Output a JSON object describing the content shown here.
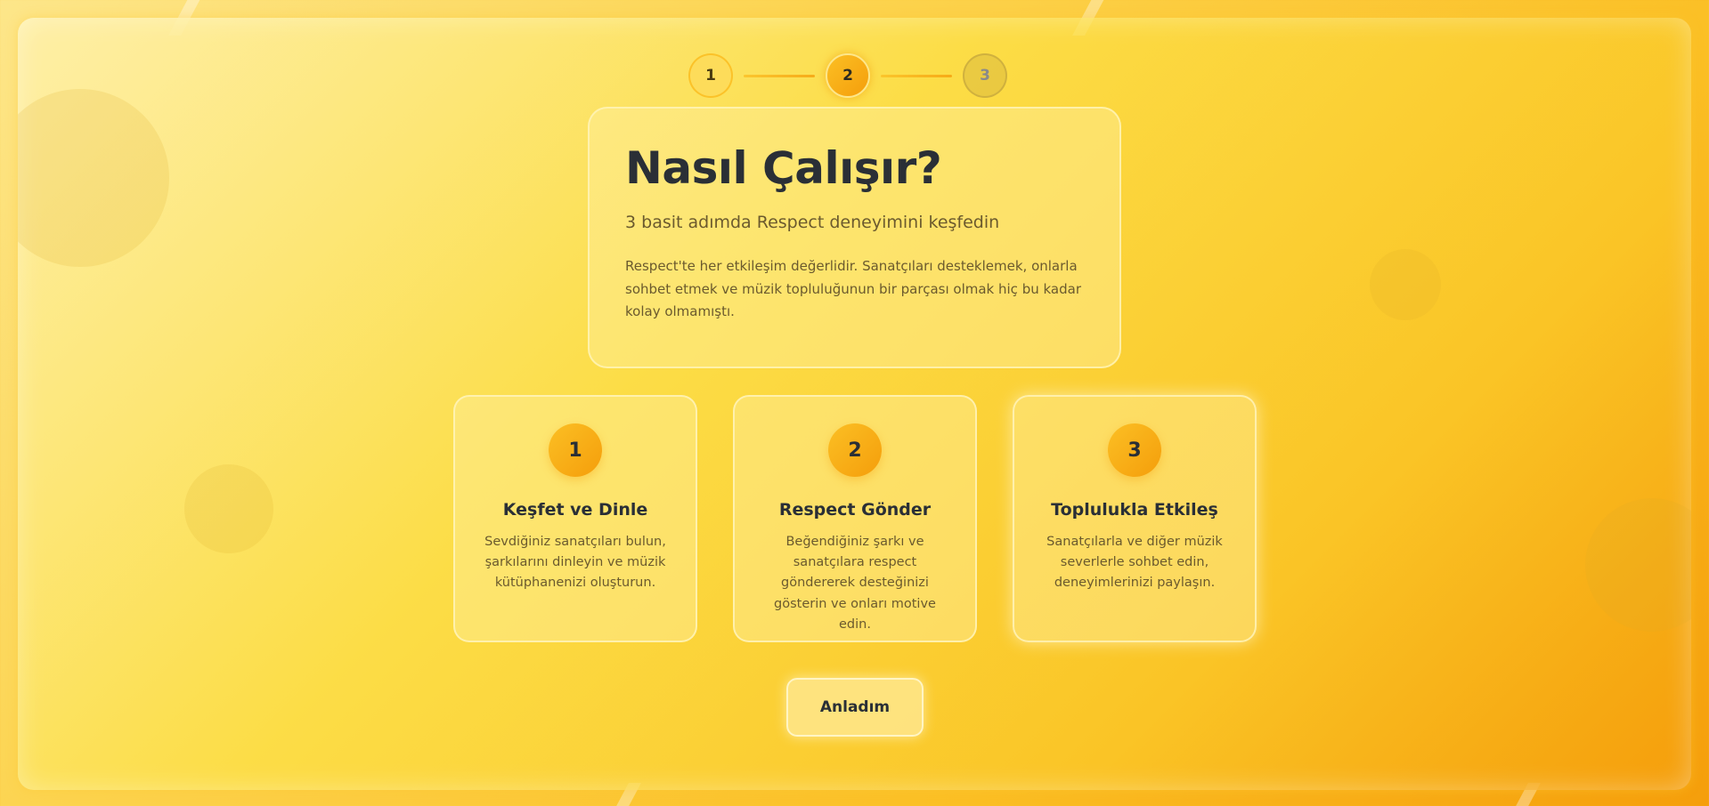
{
  "stepper": {
    "steps": [
      {
        "label": "1",
        "state": "done"
      },
      {
        "label": "2",
        "state": "active"
      },
      {
        "label": "3",
        "state": "todo"
      }
    ]
  },
  "intro": {
    "title": "Nasıl Çalışır?",
    "subtitle": "3 basit adımda Respect deneyimini keşfedin",
    "description": "Respect'te her etkileşim değerlidir. Sanatçıları desteklemek, onlarla sohbet etmek ve müzik topluluğunun bir parçası olmak hiç bu kadar kolay olmamıştı."
  },
  "cards": [
    {
      "number": "1",
      "title": "Keşfet ve Dinle",
      "text": "Sevdiğiniz sanatçıları bulun, şarkılarını dinleyin ve müzik kütüphanenizi oluşturun."
    },
    {
      "number": "2",
      "title": "Respect Gönder",
      "text": "Beğendiğiniz şarkı ve sanatçılara respect göndererek desteğinizi gösterin ve onları motive edin."
    },
    {
      "number": "3",
      "title": "Toplulukla Etkileş",
      "text": "Sanatçılarla ve diğer müzik severlerle sohbet edin, deneyimlerinizi paylaşın."
    }
  ],
  "confirm_button": {
    "label": "Anladım"
  },
  "colors": {
    "accent": "#f59e0b",
    "accent_light": "#fbbf24",
    "text_dark": "#2a2f36",
    "text_muted": "#6b5a2e"
  }
}
